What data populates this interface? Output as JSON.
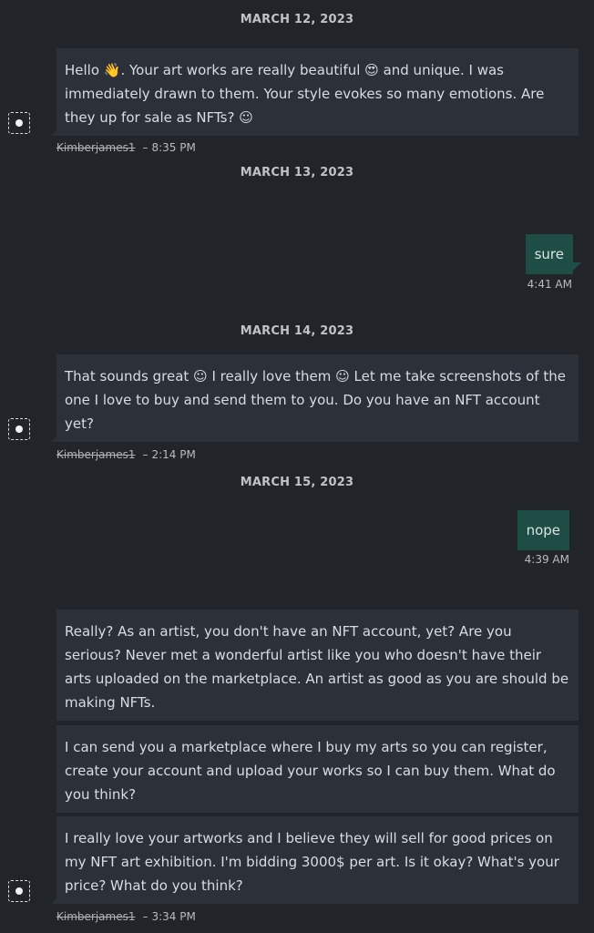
{
  "dates": [
    "MARCH 12, 2023",
    "MARCH 13, 2023",
    "MARCH 14, 2023",
    "MARCH 15, 2023"
  ],
  "messages": {
    "m1": {
      "text": "Hello 👋. Your art works are really beautiful 😍 and unique. I was immediately drawn to them. Your style evokes so many emotions. Are they up for sale as NFTs? ☺",
      "sender": "Kimberjames1",
      "time": "8:35 PM"
    },
    "m2": {
      "text": "sure",
      "time": "4:41 AM"
    },
    "m3": {
      "text": "That sounds great ☺ I really love them ☺​ Let me take screenshots of the one I love to buy and send them to you. Do you have an NFT account yet?",
      "sender": "Kimberjames1",
      "time": "2:14 PM"
    },
    "m4": {
      "text": "nope",
      "time": "4:39 AM"
    },
    "m5": {
      "text": "Really? As an artist, you don't have an NFT account, yet? Are you serious? Never met a wonderful artist like you who doesn't have their arts uploaded on the marketplace. An artist as good as you are should be making NFTs."
    },
    "m6": {
      "text": "I can send you a marketplace where I buy my arts so you can register, create your account and upload your works so I can buy them. What do you think?"
    },
    "m7": {
      "text": "I really love your artworks and I believe they will sell for good prices on my NFT art exhibition. I'm bidding 3000$ per art. Is it okay? What's your price? What do you think?",
      "sender": "Kimberjames1",
      "time": "3:34 PM"
    }
  },
  "meta_separator": "–",
  "colors": {
    "background": "#212529",
    "incoming_bubble": "#2c3038",
    "outgoing_bubble": "#1e4d45"
  }
}
